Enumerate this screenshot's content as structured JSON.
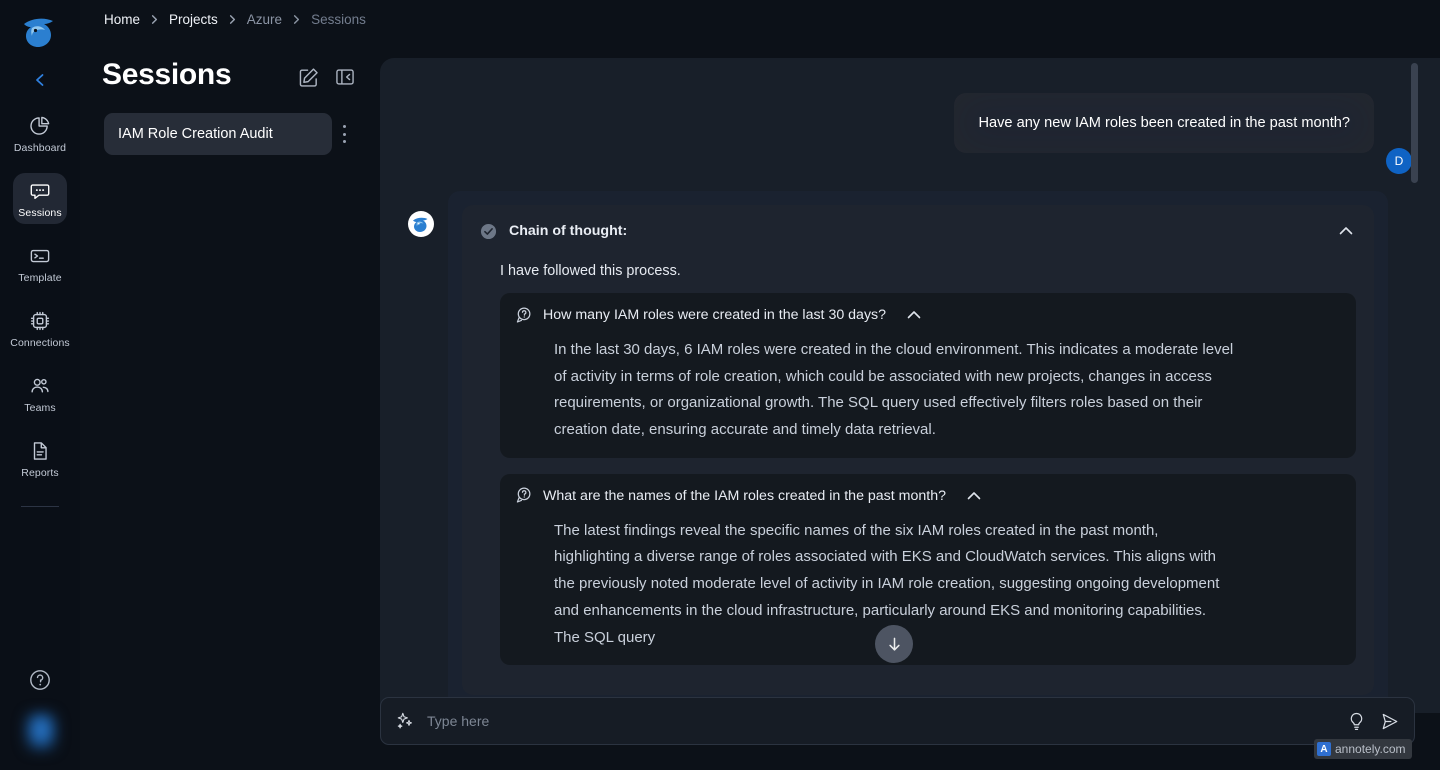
{
  "app": {
    "logo_icon": "eagle-logo",
    "accent_color": "#0f63c4",
    "panel_bg": "#181f29"
  },
  "sidebar": {
    "collapse_icon": "chevron-left-icon",
    "items": [
      {
        "label": "Dashboard",
        "icon": "pie-chart-icon",
        "active": false
      },
      {
        "label": "Sessions",
        "icon": "chat-bubble-icon",
        "active": true
      },
      {
        "label": "Template",
        "icon": "terminal-icon",
        "active": false
      },
      {
        "label": "Connections",
        "icon": "chip-icon",
        "active": false
      },
      {
        "label": "Teams",
        "icon": "people-icon",
        "active": false
      },
      {
        "label": "Reports",
        "icon": "document-icon",
        "active": false
      }
    ],
    "help_icon": "question-circle-icon"
  },
  "breadcrumb": {
    "items": [
      "Home",
      "Projects",
      "Azure",
      "Sessions"
    ]
  },
  "header": {
    "title": "Sessions",
    "edit_icon": "edit-square-icon",
    "collapse_icon": "panel-collapse-icon"
  },
  "sessions_list": {
    "items": [
      {
        "name": "IAM Role Creation Audit",
        "menu_icon": "more-vertical-icon"
      }
    ]
  },
  "conversation": {
    "user_message": {
      "text": "Have any new IAM roles been created in the past month?",
      "avatar_initial": "D"
    },
    "assistant_message": {
      "avatar_icon": "eagle-logo",
      "chain_of_thought": {
        "status_icon": "check-circle-icon",
        "title": "Chain of thought:",
        "toggle_icon": "chevron-up-icon",
        "intro": "I have followed this process.",
        "steps": [
          {
            "question_icon": "question-bubble-icon",
            "question": "How many IAM roles were created in the last 30 days?",
            "toggle_icon": "chevron-up-icon",
            "answer": "In the last 30 days, 6 IAM roles were created in the cloud environment. This indicates a moderate level of activity in terms of role creation, which could be associated with new projects, changes in access requirements, or organizational growth. The SQL query used effectively filters roles based on their creation date, ensuring accurate and timely data retrieval."
          },
          {
            "question_icon": "question-bubble-icon",
            "question": "What are the names of the IAM roles created in the past month?",
            "toggle_icon": "chevron-up-icon",
            "answer": "The latest findings reveal the specific names of the six IAM roles created in the past month, highlighting a diverse range of roles associated with EKS and CloudWatch services. This aligns with the previously noted moderate level of activity in IAM role creation, suggesting ongoing development and enhancements in the cloud infrastructure, particularly around EKS and monitoring capabilities. The SQL query"
          }
        ]
      }
    },
    "scroll_down_icon": "arrow-down-icon"
  },
  "composer": {
    "leading_icon": "sparkle-icon",
    "placeholder": "Type here",
    "value": "",
    "hint_icon": "lightbulb-icon",
    "send_icon": "send-icon"
  },
  "watermark": {
    "logo_letter": "A",
    "text": "annotely.com"
  }
}
